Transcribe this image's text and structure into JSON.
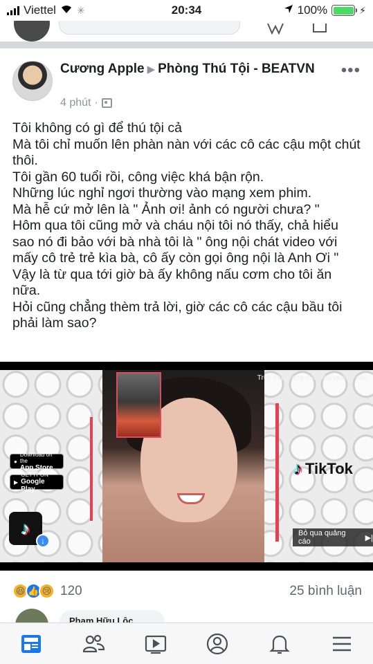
{
  "status_bar": {
    "carrier": "Viettel",
    "time": "20:34",
    "battery": "100%",
    "battery_level": 1.0
  },
  "post": {
    "author": "Cương Apple",
    "group": "Phòng Thú Tội - BEATVN",
    "time": "4 phút",
    "more_icon": "more-dots-icon",
    "text_lines": [
      "Tôi không có gì để thú tội cả",
      "Mà tôi chỉ muốn lên phàn nàn với các cô các cậu một chút thôi.",
      "Tôi gần 60 tuổi rồi, công việc khá bận rộn.",
      "Những lúc nghỉ ngơi thường vào mạng xem phim.",
      "Mà hễ cứ mở lên là \" Ảnh ơi! ảnh có người chưa? \"",
      "Hôm qua tôi cũng mở và cháu nội tôi nó thấy, chả hiểu sao nó đi bảo với bà nhà tôi là \" ông nội chát video với mấy cô trẻ trẻ kìa bà, cô ấy còn gọi ông nội là Anh Ơi \"",
      "Vậy là từ qua tới giờ bà ấy không nấu cơm cho tôi ăn nữa.",
      "Hỏi cũng chẳng thèm trả lời, giờ các cô các cậu bầu tôi phải làm sao?"
    ]
  },
  "video_ad": {
    "ad_link": "Truy cập trang của nhà quảng cáo",
    "app_store": {
      "small": "Download on the",
      "big": "App Store"
    },
    "google_play": {
      "small": "GET IT ON",
      "big": "Google Play"
    },
    "brand": "TikTok",
    "skip_label": "Bỏ qua quảng cáo"
  },
  "engagement": {
    "reaction_count": "120",
    "comments": "25 bình luận",
    "reactions": [
      "haha",
      "like",
      "sad"
    ]
  },
  "next_comment": {
    "name": "Phạm Hữu Lộc"
  },
  "nav": {
    "items": [
      "news-feed-icon",
      "friends-icon",
      "watch-icon",
      "profile-icon",
      "notifications-icon",
      "menu-icon"
    ],
    "active_color": "#1877f2",
    "inactive_color": "#4b4f56"
  }
}
